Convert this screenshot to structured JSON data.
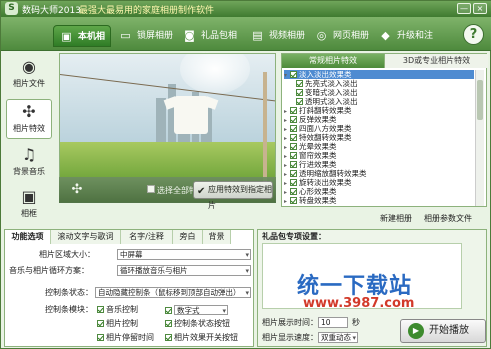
{
  "window": {
    "app_name": "数码大师2013",
    "slogan": "最强大最易用的家庭相册制作软件",
    "minimize_glyph": "—",
    "close_glyph": "×"
  },
  "toolbar": {
    "tabs": [
      {
        "label": "本机相册",
        "icon": "album-icon"
      },
      {
        "label": "锁屏相册",
        "icon": "screen-icon"
      },
      {
        "label": "礼品包相册",
        "icon": "gift-icon"
      },
      {
        "label": "视频相册",
        "icon": "film-icon"
      },
      {
        "label": "网页相册",
        "icon": "web-icon"
      },
      {
        "label": "升级和注册",
        "icon": "upgrade-icon"
      }
    ],
    "help_label": "?"
  },
  "leftnav": [
    {
      "label": "相片文件",
      "icon": "camera-icon"
    },
    {
      "label": "相片特效",
      "icon": "effects-icon"
    },
    {
      "label": "背景音乐",
      "icon": "music-icon"
    },
    {
      "label": "相框",
      "icon": "frame-icon"
    }
  ],
  "preview": {
    "select_all_label": "选择全部特效",
    "apply_button_label": "应用特效到指定相片"
  },
  "effects": {
    "tabs": [
      "常规相片特效",
      "3D或专业相片特效"
    ],
    "items": [
      {
        "label": "淡入淡出效果类",
        "level": 0,
        "checked": true,
        "highlight": true
      },
      {
        "label": "先亮式淡入淡出",
        "level": 1,
        "checked": true
      },
      {
        "label": "变暗式淡入淡出",
        "level": 1,
        "checked": true
      },
      {
        "label": "透明式淡入淡出",
        "level": 1,
        "checked": true
      },
      {
        "label": "打斜翻转效果类",
        "level": 0,
        "checked": true
      },
      {
        "label": "反弹效果类",
        "level": 0,
        "checked": true
      },
      {
        "label": "四面八方效果类",
        "level": 0,
        "checked": true
      },
      {
        "label": "特效翻转效果类",
        "level": 0,
        "checked": true
      },
      {
        "label": "光晕效果类",
        "level": 0,
        "checked": true
      },
      {
        "label": "窗帘效果类",
        "level": 0,
        "checked": true
      },
      {
        "label": "行进效果类",
        "level": 0,
        "checked": true
      },
      {
        "label": "透明缩放翻转效果类",
        "level": 0,
        "checked": true
      },
      {
        "label": "旋转淡出效果类",
        "level": 0,
        "checked": true
      },
      {
        "label": "心形效果类",
        "level": 0,
        "checked": true
      },
      {
        "label": "转盘效果类",
        "level": 0,
        "checked": true
      }
    ]
  },
  "subbar": {
    "new_album": "新建相册",
    "album_file": "相册参数文件"
  },
  "bottom": {
    "tabs": [
      "功能选项",
      "滚动文字与歌词",
      "名字/注释",
      "旁白",
      "背景"
    ],
    "fields": [
      {
        "label": "相片区域大小：",
        "value": "中屏幕"
      },
      {
        "label": "音乐与相片循环方案：",
        "value": "循环播放音乐与相片"
      },
      {
        "label": "控制条状态：",
        "value": "自动隐藏控制条（鼠标移到顶部自动弹出）"
      }
    ],
    "control_label": "控制条模块：",
    "checks": [
      {
        "label": "音乐控制",
        "checked": true
      },
      {
        "label": "数字式",
        "checked": true
      },
      {
        "label": "相片控制",
        "checked": true
      },
      {
        "label": "控制条状态按钮",
        "checked": true
      },
      {
        "label": "相片停留时间",
        "checked": true
      },
      {
        "label": "相片效果开关按钮",
        "checked": true
      }
    ]
  },
  "gift": {
    "title": "礼品包专项设置：",
    "watermark": "统一下载站",
    "watermark_url": "www.3987.com",
    "interval_label": "相片展示时间：",
    "interval_value": "10",
    "interval_unit": "秒",
    "speed_label": "相片显示速度：",
    "speed_value": "双重动态",
    "play_label": "开始播放"
  }
}
